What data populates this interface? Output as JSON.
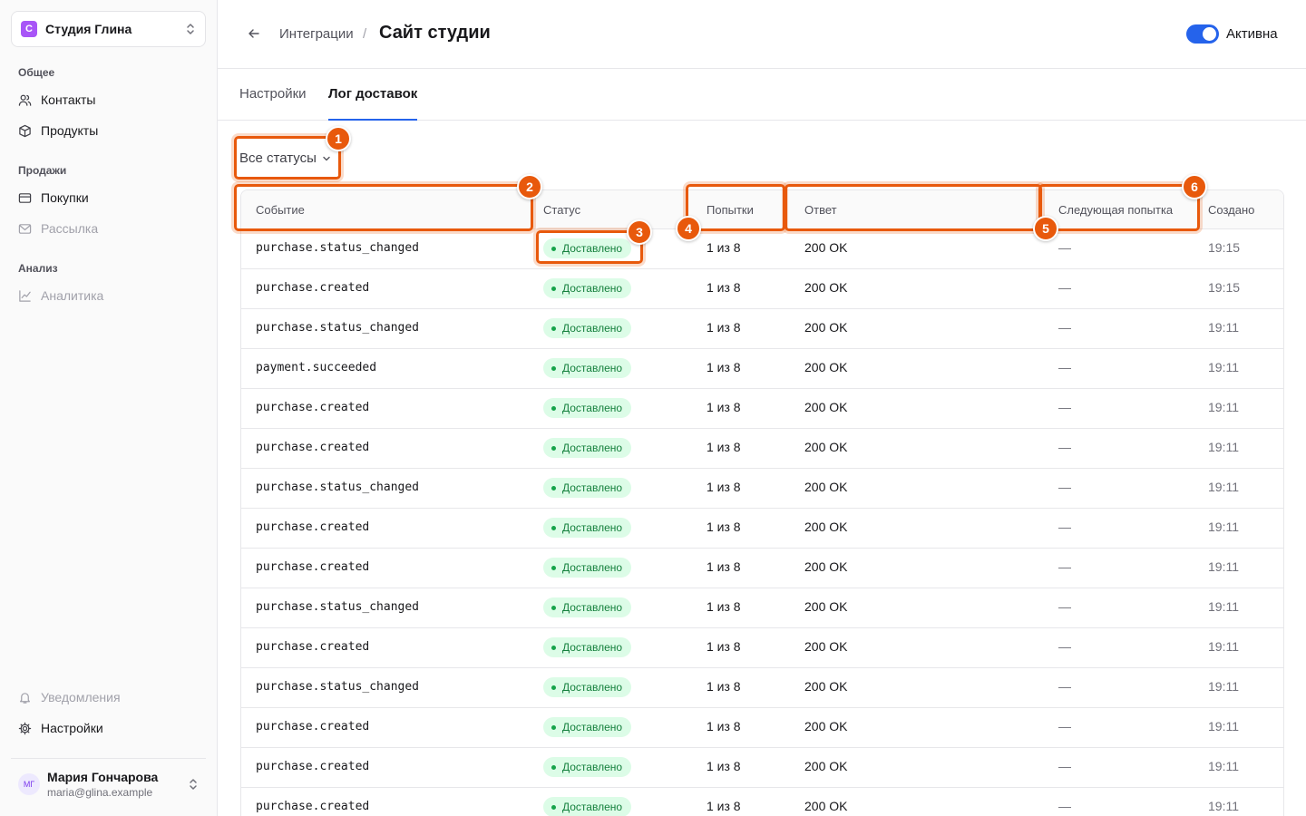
{
  "sidebar": {
    "workspace": {
      "logo": "С",
      "name": "Студия Глина"
    },
    "sections": [
      {
        "title": "Общее",
        "items": [
          {
            "label": "Контакты",
            "icon": "users-icon"
          },
          {
            "label": "Продукты",
            "icon": "box-icon"
          }
        ]
      },
      {
        "title": "Продажи",
        "items": [
          {
            "label": "Покупки",
            "icon": "card-icon"
          },
          {
            "label": "Рассылка",
            "icon": "mail-icon",
            "disabled": true
          }
        ]
      },
      {
        "title": "Анализ",
        "items": [
          {
            "label": "Аналитика",
            "icon": "chart-icon",
            "disabled": true
          }
        ]
      }
    ],
    "bottom": [
      {
        "label": "Уведомления",
        "icon": "bell-icon",
        "disabled": true
      },
      {
        "label": "Настройки",
        "icon": "gear-icon"
      }
    ],
    "user": {
      "initials": "МГ",
      "name": "Мария Гончарова",
      "email": "maria@glina.example"
    }
  },
  "header": {
    "breadcrumb": "Интеграции",
    "separator": "/",
    "title": "Сайт студии",
    "toggle_label": "Активна",
    "toggle_on": true
  },
  "tabs": [
    {
      "label": "Настройки",
      "active": false
    },
    {
      "label": "Лог доставок",
      "active": true
    }
  ],
  "filter": {
    "label": "Все статусы"
  },
  "table": {
    "columns": [
      "Событие",
      "Статус",
      "Попытки",
      "Ответ",
      "Следующая попытка",
      "Создано"
    ],
    "rows": [
      {
        "event": "purchase.status_changed",
        "status": "Доставлено",
        "attempts": "1 из 8",
        "response": "200 OK",
        "next": "—",
        "created": "19:15"
      },
      {
        "event": "purchase.created",
        "status": "Доставлено",
        "attempts": "1 из 8",
        "response": "200 OK",
        "next": "—",
        "created": "19:15"
      },
      {
        "event": "purchase.status_changed",
        "status": "Доставлено",
        "attempts": "1 из 8",
        "response": "200 OK",
        "next": "—",
        "created": "19:11"
      },
      {
        "event": "payment.succeeded",
        "status": "Доставлено",
        "attempts": "1 из 8",
        "response": "200 OK",
        "next": "—",
        "created": "19:11"
      },
      {
        "event": "purchase.created",
        "status": "Доставлено",
        "attempts": "1 из 8",
        "response": "200 OK",
        "next": "—",
        "created": "19:11"
      },
      {
        "event": "purchase.created",
        "status": "Доставлено",
        "attempts": "1 из 8",
        "response": "200 OK",
        "next": "—",
        "created": "19:11"
      },
      {
        "event": "purchase.status_changed",
        "status": "Доставлено",
        "attempts": "1 из 8",
        "response": "200 OK",
        "next": "—",
        "created": "19:11"
      },
      {
        "event": "purchase.created",
        "status": "Доставлено",
        "attempts": "1 из 8",
        "response": "200 OK",
        "next": "—",
        "created": "19:11"
      },
      {
        "event": "purchase.created",
        "status": "Доставлено",
        "attempts": "1 из 8",
        "response": "200 OK",
        "next": "—",
        "created": "19:11"
      },
      {
        "event": "purchase.status_changed",
        "status": "Доставлено",
        "attempts": "1 из 8",
        "response": "200 OK",
        "next": "—",
        "created": "19:11"
      },
      {
        "event": "purchase.created",
        "status": "Доставлено",
        "attempts": "1 из 8",
        "response": "200 OK",
        "next": "—",
        "created": "19:11"
      },
      {
        "event": "purchase.status_changed",
        "status": "Доставлено",
        "attempts": "1 из 8",
        "response": "200 OK",
        "next": "—",
        "created": "19:11"
      },
      {
        "event": "purchase.created",
        "status": "Доставлено",
        "attempts": "1 из 8",
        "response": "200 OK",
        "next": "—",
        "created": "19:11"
      },
      {
        "event": "purchase.created",
        "status": "Доставлено",
        "attempts": "1 из 8",
        "response": "200 OK",
        "next": "—",
        "created": "19:11"
      },
      {
        "event": "purchase.created",
        "status": "Доставлено",
        "attempts": "1 из 8",
        "response": "200 OK",
        "next": "—",
        "created": "19:11"
      }
    ]
  },
  "annotations": [
    {
      "label": "1",
      "target": "status-filter"
    },
    {
      "label": "2",
      "target": "column-event"
    },
    {
      "label": "3",
      "target": "status-badge"
    },
    {
      "label": "4",
      "target": "column-attempts"
    },
    {
      "label": "5",
      "target": "column-response"
    },
    {
      "label": "6",
      "target": "column-next-attempt"
    }
  ],
  "colors": {
    "accent": "#2563eb",
    "annotation": "#e8590c",
    "success_bg": "#dcfce7",
    "success_text": "#15803d",
    "workspace_logo": "#a855f7"
  }
}
